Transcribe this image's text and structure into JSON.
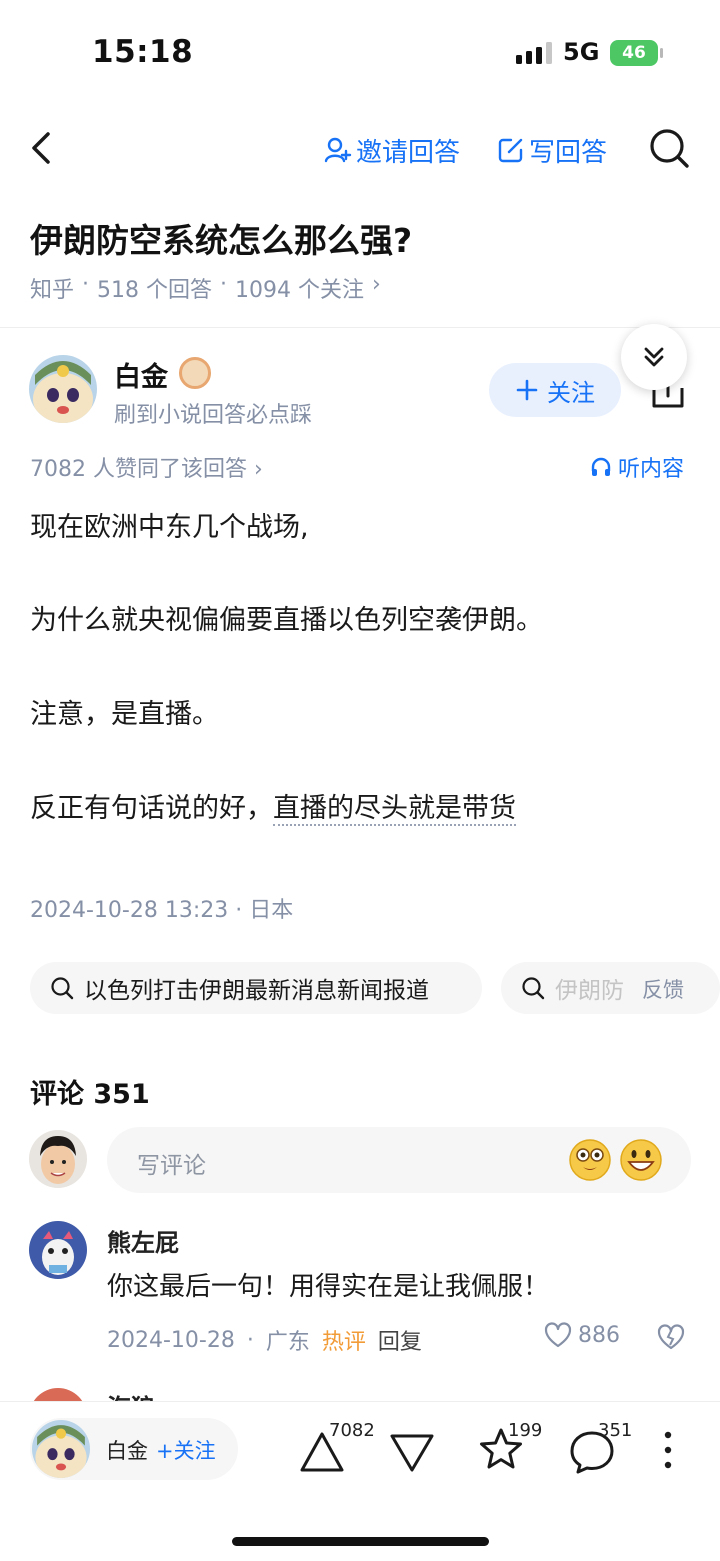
{
  "status": {
    "time": "15:18",
    "network": "5G",
    "battery": "46"
  },
  "nav": {
    "invite_label": "邀请回答",
    "write_label": "写回答"
  },
  "question": {
    "title": "伊朗防空系统怎么那么强?",
    "meta_source": "知乎",
    "meta_answers": "518 个回答",
    "meta_follows": "1094 个关注"
  },
  "author": {
    "name": "白金",
    "description": "刷到小说回答必点踩",
    "follow_label": "关注"
  },
  "answer": {
    "votes_text": "7082 人赞同了该回答",
    "listen_label": "听内容",
    "paragraphs": [
      "现在欧洲中东几个战场,",
      "为什么就央视偏偏要直播以色列空袭伊朗。",
      "注意，是直播。",
      "反正有句话说的好，",
      "直播的尽头就是带货"
    ],
    "timestamp": "2024-10-28 13:23 · 日本"
  },
  "related": {
    "chips": [
      "以色列打击伊朗最新消息新闻报道",
      "伊朗防"
    ],
    "feedback_label": "反馈"
  },
  "comments": {
    "title": "评论 351",
    "input_placeholder": "写评论",
    "items": [
      {
        "name": "熊左屁",
        "text": "你这最后一句！用得实在是让我佩服！",
        "date": "2024-10-28",
        "location": "广东",
        "hot_label": "热评",
        "reply_label": "回复",
        "likes": "886"
      }
    ],
    "peek_name": "海狼"
  },
  "bottom": {
    "author_name": "白金",
    "follow_label": "+关注",
    "upvote_count": "7082",
    "star_count": "199",
    "comment_count": "351"
  },
  "colors": {
    "accent": "#1772f6",
    "meta_gray": "#8590a6",
    "hot": "#f29c38"
  }
}
